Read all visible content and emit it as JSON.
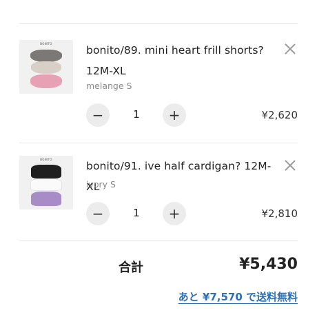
{
  "cart": {
    "items": [
      {
        "brand_tag": "BONITO",
        "name_line1": "bonito/89. mini heart frill shorts?",
        "name_line2": "12M-XL",
        "variant": "melange S",
        "quantity": "1",
        "price": "¥2,620",
        "decrease_symbol": "−",
        "increase_symbol": "+"
      },
      {
        "brand_tag": "BONITO",
        "name_line1": "bonito/91. ive half cardigan? 12M-XL",
        "name_line2": "",
        "variant": "ivory S",
        "quantity": "1",
        "price": "¥2,810",
        "decrease_symbol": "−",
        "increase_symbol": "+"
      }
    ],
    "total_label": "合計",
    "total_value": "¥5,430",
    "free_shipping_notice": "あと ¥7,570 で送料無料"
  },
  "icons": {
    "remove": "close-icon",
    "decrease": "minus-icon",
    "increase": "plus-icon"
  },
  "colors": {
    "link": "#2d6fb8",
    "button_bg": "#ececec"
  }
}
